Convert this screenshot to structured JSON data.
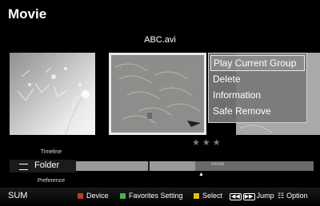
{
  "header": {
    "title": "Movie"
  },
  "current_file": "ABC.avi",
  "context_menu": {
    "items": [
      {
        "label": "Play Current Group",
        "selected": true
      },
      {
        "label": "Delete",
        "selected": false
      },
      {
        "label": "Information",
        "selected": false
      },
      {
        "label": "Safe Remove",
        "selected": false
      }
    ]
  },
  "rating": {
    "text": "★★★"
  },
  "tabs": {
    "upper": "Timeline",
    "current": "Folder",
    "lower": "Preference"
  },
  "progress": {
    "label": "movie",
    "fraction": 0.5
  },
  "bottom_bar": {
    "sum_label": "SUM",
    "device_label": "Device",
    "favorites_label": "Favorites Setting",
    "select_label": "Select",
    "jump_label": "Jump",
    "option_label": "Option",
    "colors": {
      "red": "#c0392b",
      "green": "#4caf50",
      "yellow": "#e6c200",
      "blue": "#2f6fd6"
    }
  }
}
